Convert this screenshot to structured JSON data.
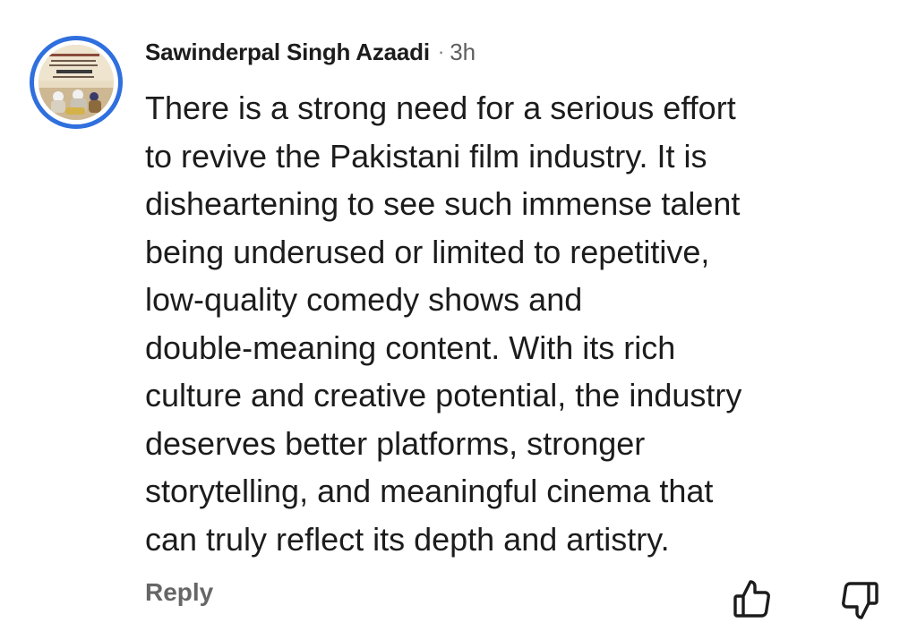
{
  "comment": {
    "author": "Sawinderpal Singh Azaadi",
    "separator": "·",
    "timestamp": "3h",
    "text_lines": [
      "There is a strong need for a serious effort",
      "to revive the Pakistani film industry. It is",
      "disheartening to see such immense talent",
      "being underused or limited to repetitive,",
      "low-quality comedy shows and",
      "double-meaning content. With its rich",
      "culture and creative potential, the industry",
      "deserves better platforms, stronger",
      "storytelling, and meaningful cinema that",
      "can truly reflect its depth and artistry."
    ]
  },
  "actions": {
    "reply_label": "Reply",
    "like_icon": "thumbs-up-icon",
    "dislike_icon": "thumbs-down-icon"
  },
  "colors": {
    "avatar_ring": "#2f6fde",
    "text": "#1c1c1c",
    "muted": "#666666"
  }
}
